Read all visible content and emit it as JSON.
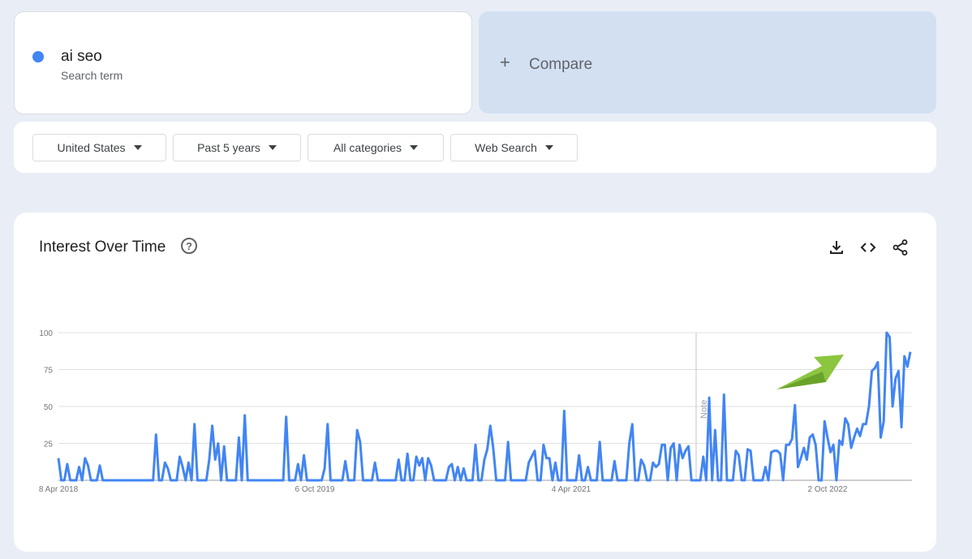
{
  "search": {
    "term": "ai seo",
    "term_caption": "Search term",
    "term_color": "#4285f4",
    "compare_icon": "+",
    "compare_label": "Compare"
  },
  "filters": [
    {
      "label": "United States"
    },
    {
      "label": "Past 5 years"
    },
    {
      "label": "All categories"
    },
    {
      "label": "Web Search"
    }
  ],
  "chart_panel": {
    "title": "Interest Over Time",
    "help_icon": "?",
    "icons": [
      "download-icon",
      "embed-code-icon",
      "share-icon"
    ],
    "note_marker": "Note",
    "annotation": "green-arrow pointing up-right"
  },
  "chart_data": {
    "type": "line",
    "series": [
      {
        "name": "ai seo",
        "color": "#4285f4",
        "values": [
          15,
          0,
          0,
          11,
          0,
          0,
          0,
          9,
          0,
          15,
          10,
          0,
          0,
          0,
          10,
          0,
          0,
          0,
          0,
          0,
          0,
          0,
          0,
          0,
          0,
          0,
          0,
          0,
          0,
          0,
          0,
          0,
          0,
          31,
          0,
          0,
          12,
          8,
          0,
          0,
          0,
          16,
          9,
          0,
          12,
          0,
          38,
          0,
          0,
          0,
          0,
          14,
          37,
          14,
          25,
          0,
          23,
          0,
          0,
          0,
          0,
          29,
          0,
          44,
          0,
          0,
          0,
          0,
          0,
          0,
          0,
          0,
          0,
          0,
          0,
          0,
          0,
          43,
          0,
          0,
          0,
          11,
          0,
          17,
          0,
          0,
          0,
          0,
          0,
          0,
          8,
          38,
          0,
          0,
          0,
          0,
          0,
          13,
          0,
          0,
          0,
          34,
          26,
          0,
          0,
          0,
          0,
          12,
          0,
          0,
          0,
          0,
          0,
          0,
          0,
          14,
          0,
          0,
          18,
          0,
          0,
          16,
          10,
          15,
          0,
          15,
          10,
          0,
          0,
          0,
          0,
          0,
          9,
          11,
          0,
          9,
          0,
          8,
          0,
          0,
          0,
          24,
          0,
          0,
          14,
          21,
          37,
          22,
          0,
          0,
          0,
          0,
          26,
          0,
          0,
          0,
          0,
          0,
          0,
          12,
          16,
          20,
          0,
          0,
          24,
          15,
          15,
          0,
          12,
          0,
          0,
          47,
          0,
          0,
          0,
          0,
          17,
          0,
          0,
          9,
          0,
          0,
          0,
          26,
          0,
          0,
          0,
          0,
          13,
          0,
          0,
          0,
          0,
          25,
          38,
          0,
          0,
          14,
          10,
          0,
          0,
          12,
          9,
          11,
          24,
          24,
          0,
          22,
          25,
          0,
          24,
          15,
          20,
          23,
          0,
          0,
          0,
          0,
          16,
          0,
          56,
          0,
          34,
          0,
          0,
          58,
          0,
          0,
          0,
          20,
          17,
          0,
          0,
          21,
          20,
          0,
          0,
          0,
          0,
          9,
          0,
          19,
          20,
          20,
          18,
          0,
          24,
          24,
          28,
          51,
          9,
          15,
          22,
          14,
          29,
          31,
          24,
          0,
          0,
          40,
          29,
          19,
          24,
          0,
          27,
          24,
          42,
          38,
          22,
          29,
          35,
          30,
          38,
          38,
          50,
          74,
          76,
          80,
          29,
          40,
          100,
          97,
          50,
          69,
          74,
          36,
          84,
          77,
          87
        ],
        "max_estimated": 100
      }
    ],
    "x_tick_labels": [
      "8 Apr 2018",
      "6 Oct 2019",
      "4 Apr 2021",
      "2 Oct 2022"
    ],
    "x_range": [
      "2018-04-08",
      "2023-04-02"
    ],
    "y_ticks": [
      100,
      75,
      50,
      25
    ],
    "ylim": [
      0,
      100
    ],
    "grid": true,
    "note_position": "2021-12"
  }
}
